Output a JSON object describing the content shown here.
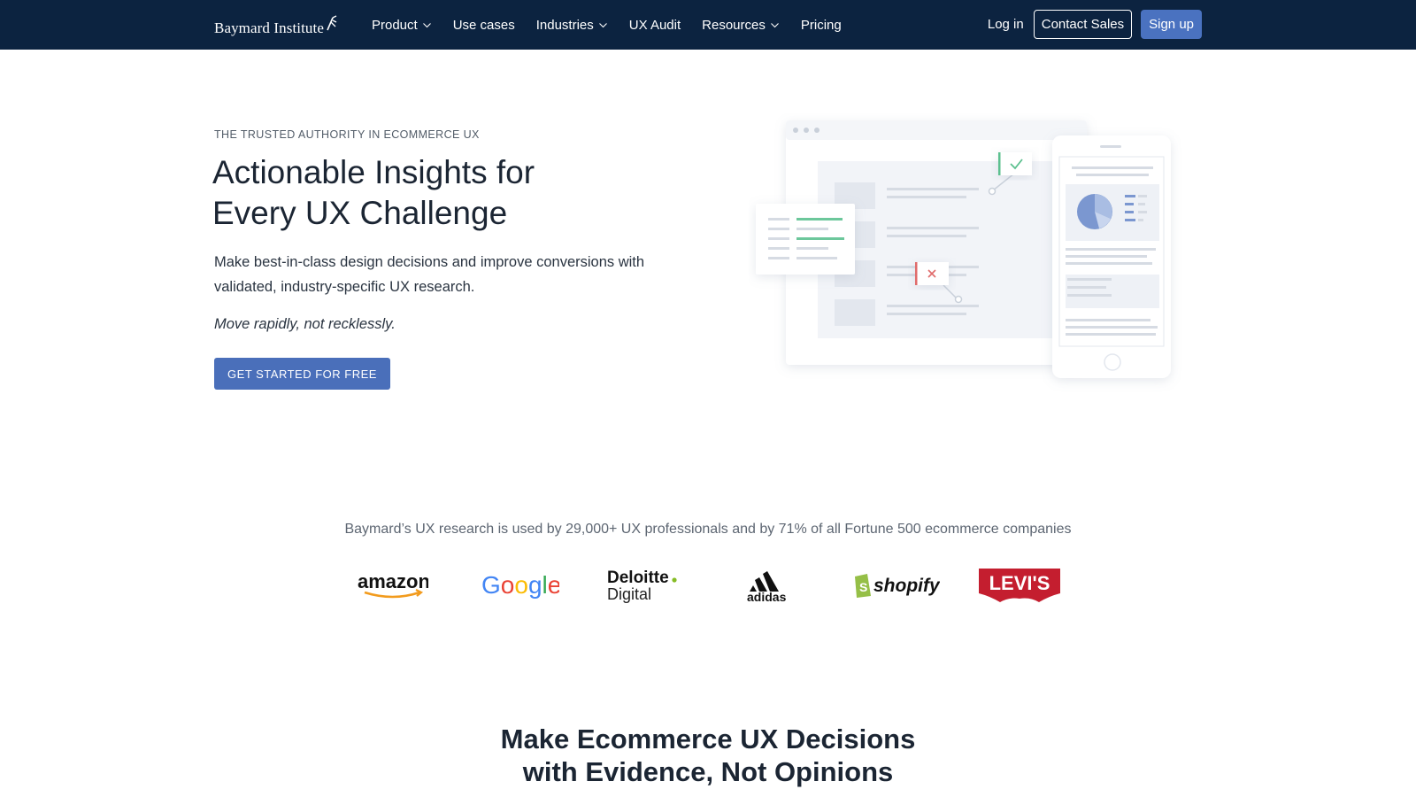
{
  "nav": {
    "logo_text": "Baymard Institute",
    "items": [
      {
        "label": "Product",
        "has_dropdown": true
      },
      {
        "label": "Use cases",
        "has_dropdown": false
      },
      {
        "label": "Industries",
        "has_dropdown": true
      },
      {
        "label": "UX Audit",
        "has_dropdown": false
      },
      {
        "label": "Resources",
        "has_dropdown": true
      },
      {
        "label": "Pricing",
        "has_dropdown": false
      }
    ],
    "login": "Log in",
    "contact": "Contact Sales",
    "signup": "Sign up",
    "bg_color": "#0c2340"
  },
  "hero": {
    "eyebrow": "THE TRUSTED AUTHORITY IN ECOMMERCE UX",
    "headline_line1": "Actionable Insights for",
    "headline_line2": "Every UX Challenge",
    "lede": "Make best-in-class design decisions and improve conversions with validated, industry-specific UX research.",
    "tagline": "Move rapidly, not recklessly.",
    "cta": "GET STARTED FOR FREE",
    "accent_color": "#4a6fba"
  },
  "proof": {
    "text": "Baymard’s UX research is used by 29,000+ UX professionals and by 71% of all Fortune 500 ecommerce companies",
    "logos": [
      {
        "name": "amazon",
        "icon": "amazon-logo"
      },
      {
        "name": "Google",
        "icon": "google-logo"
      },
      {
        "name": "Deloitte. Digital",
        "icon": "deloitte-digital-logo"
      },
      {
        "name": "adidas",
        "icon": "adidas-logo"
      },
      {
        "name": "shopify",
        "icon": "shopify-logo"
      },
      {
        "name": "LEVI'S",
        "icon": "levis-logo"
      }
    ]
  },
  "section": {
    "title_line1": "Make Ecommerce UX Decisions",
    "title_line2": "with Evidence, Not Opinions"
  }
}
